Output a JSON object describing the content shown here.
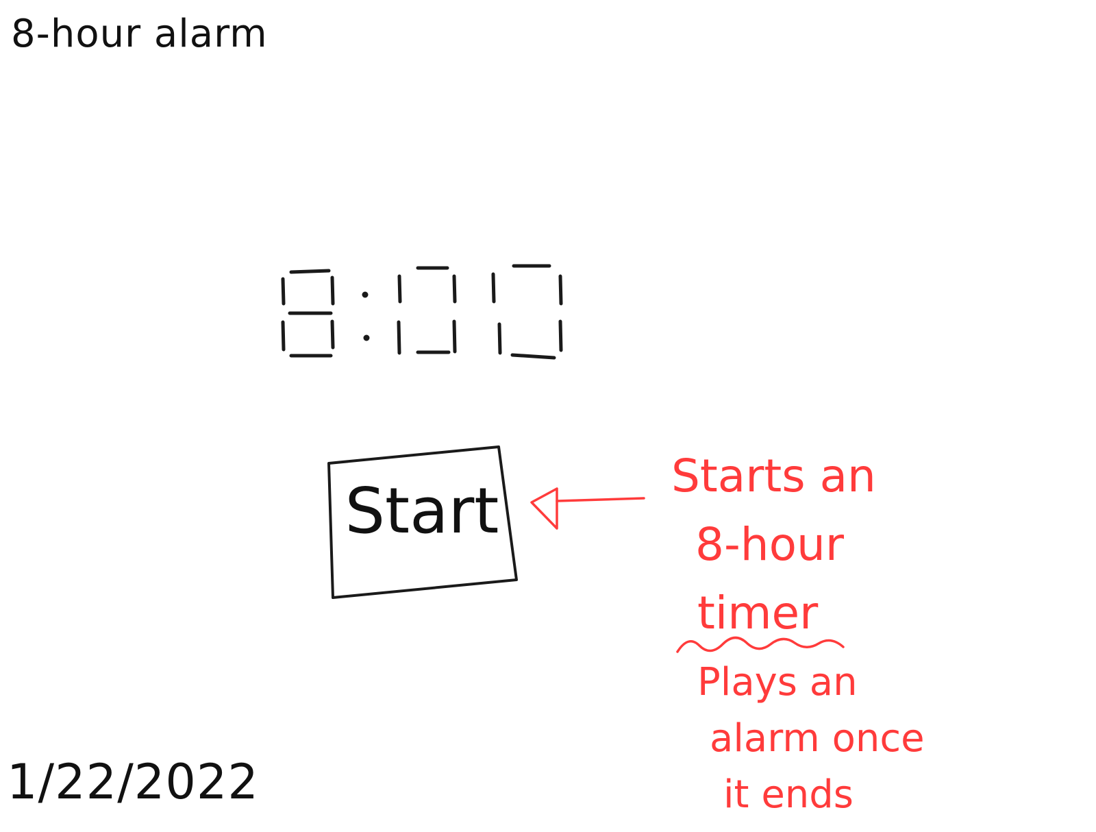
{
  "app": {
    "title": "8-hour alarm",
    "date": "1/22/2022"
  },
  "clock": {
    "display": "8:00"
  },
  "start_button": {
    "label": "Start"
  },
  "annotations": {
    "start_note": [
      "Starts an",
      "8-hour",
      "timer"
    ],
    "alarm_note": [
      "Plays an",
      "alarm once",
      "it ends"
    ]
  },
  "colors": {
    "sketch": "#1a1a1a",
    "annotation": "#ff3b3b",
    "background": "#ffffff"
  }
}
